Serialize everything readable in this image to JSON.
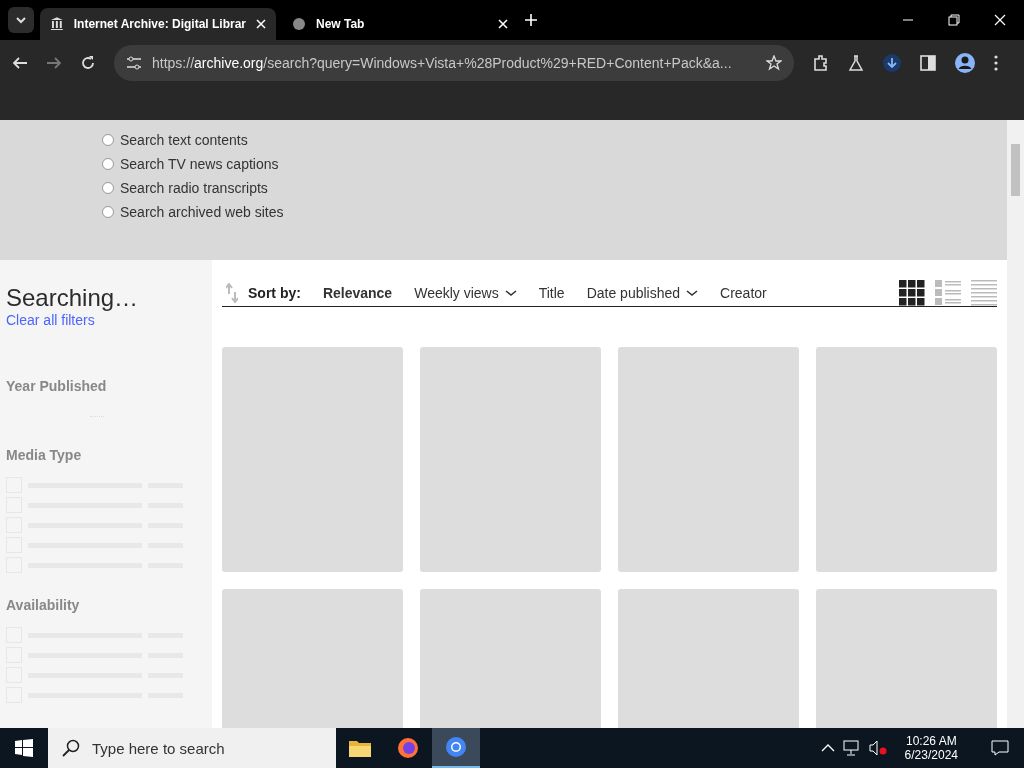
{
  "browser": {
    "tabs": [
      {
        "title": "Internet Archive: Digital Librar",
        "selected": true
      },
      {
        "title": "New Tab",
        "selected": false
      }
    ],
    "url": {
      "scheme": "https://",
      "domain": "archive.org",
      "rest": "/search?query=Windows+Vista+%28Product%29+RED+Content+Pack&a..."
    }
  },
  "search_options": [
    {
      "label": "Search text contents",
      "selected": false
    },
    {
      "label": "Search TV news captions",
      "selected": false
    },
    {
      "label": "Search radio transcripts",
      "selected": false
    },
    {
      "label": "Search archived web sites",
      "selected": false
    }
  ],
  "sidebar": {
    "title": "Searching…",
    "clear_link": "Clear all filters",
    "facets": [
      {
        "title": "Year Published",
        "kind": "histogram"
      },
      {
        "title": "Media Type",
        "kind": "list"
      },
      {
        "title": "Availability",
        "kind": "list"
      }
    ]
  },
  "sort_bar": {
    "label": "Sort by:",
    "options": [
      {
        "label": "Relevance",
        "selected": true,
        "has_menu": false
      },
      {
        "label": "Weekly views",
        "selected": false,
        "has_menu": true
      },
      {
        "label": "Title",
        "selected": false,
        "has_menu": false
      },
      {
        "label": "Date published",
        "selected": false,
        "has_menu": true
      },
      {
        "label": "Creator",
        "selected": false,
        "has_menu": false
      }
    ],
    "views": [
      {
        "kind": "grid",
        "selected": true
      },
      {
        "kind": "list",
        "selected": false
      },
      {
        "kind": "compact",
        "selected": false
      }
    ]
  },
  "taskbar": {
    "search_placeholder": "Type here to search",
    "time": "10:26 AM",
    "date": "6/23/2024"
  }
}
